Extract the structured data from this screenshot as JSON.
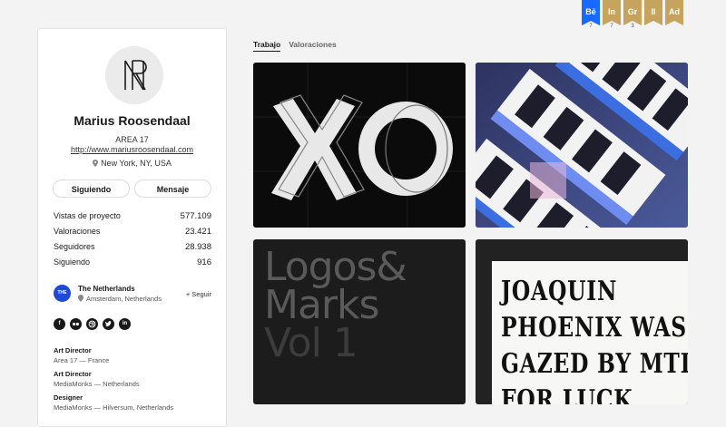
{
  "profile": {
    "name": "Marius Roosendaal",
    "company": "AREA 17",
    "website": "http://www.mariusroosendaal.com",
    "location": "New York, NY, USA",
    "avatar_icon": "monogram-icon",
    "follow_label": "Siguiendo",
    "message_label": "Mensaje",
    "stats": [
      {
        "label": "Vistas de proyecto",
        "value": "577.109"
      },
      {
        "label": "Valoraciones",
        "value": "23.421"
      },
      {
        "label": "Seguidores",
        "value": "28.938"
      },
      {
        "label": "Siguiendo",
        "value": "916"
      }
    ],
    "team": {
      "logo_text": "THE",
      "name": "The Netherlands",
      "location": "Amsterdam, Netherlands",
      "follow_label": "+ Seguir"
    },
    "social": [
      "f",
      "ff",
      "dr",
      "tw",
      "in"
    ],
    "experience": [
      {
        "role": "Art Director",
        "detail": "Area 17 — France"
      },
      {
        "role": "Art Director",
        "detail": "MediaMonks — Netherlands"
      },
      {
        "role": "Designer",
        "detail": "MediaMonks — Hilversum, Netherlands"
      }
    ]
  },
  "tabs": [
    {
      "label": "Trabajo",
      "active": true
    },
    {
      "label": "Valoraciones",
      "active": false
    }
  ],
  "ribbons": [
    {
      "label": "Bē",
      "count": "7",
      "color": "#1769ff"
    },
    {
      "label": "In",
      "count": "7",
      "color": "#c7a45e"
    },
    {
      "label": "Gr",
      "count": "3",
      "color": "#c7a45e"
    },
    {
      "label": "Il",
      "count": "",
      "color": "#c7a45e"
    },
    {
      "label": "Ad",
      "count": "",
      "color": "#c7a45e"
    }
  ],
  "projects": {
    "p3_line1": "Logos&",
    "p3_line2": "Marks",
    "p3_line3": "Vol 1",
    "p4_text": "JOAQUIN\nPHOENIX WAS\nGAZED BY MTL\nFOR LUCK"
  }
}
